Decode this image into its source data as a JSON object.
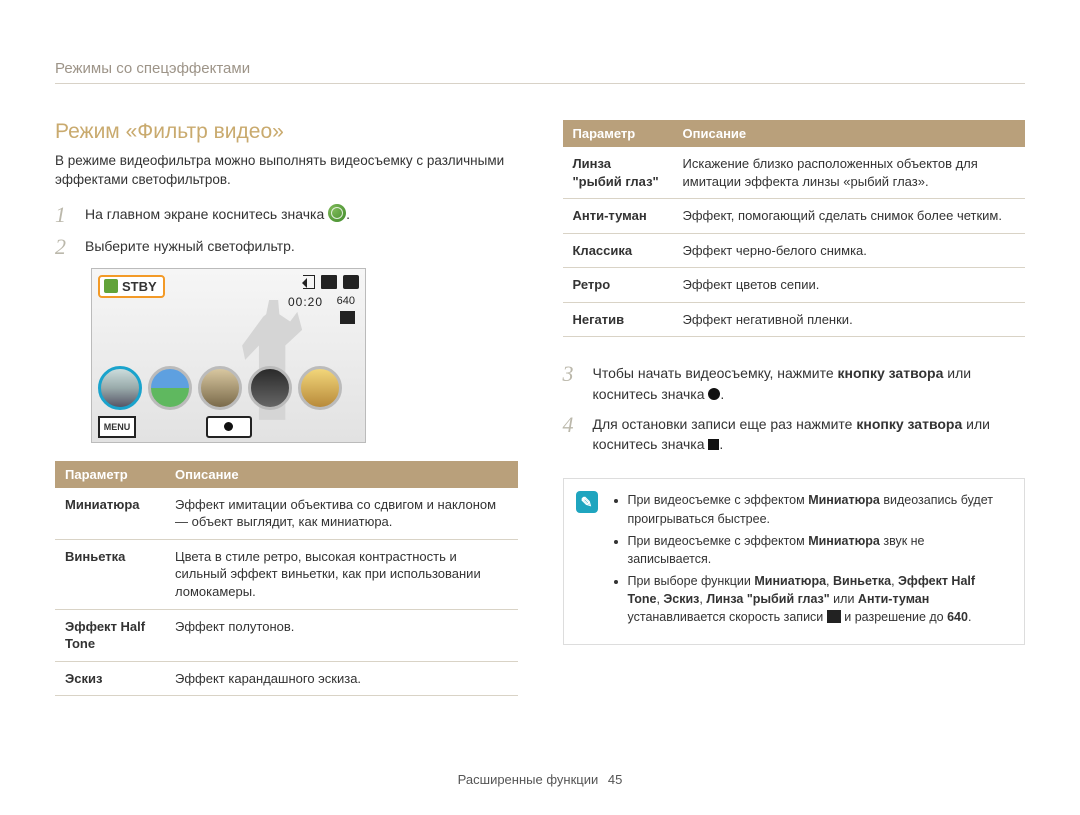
{
  "breadcrumb": "Режимы со спецэффектами",
  "title": "Режим «Фильтр видео»",
  "intro": "В режиме видеофильтра можно выполнять видеосъемку с различными эффектами светофильтров.",
  "steps": {
    "s1_pre": "На главном экране коснитесь значка ",
    "s1_post": ".",
    "s2": "Выберите нужный светофильтр.",
    "s3_pre": "Чтобы начать видеосъемку, нажмите ",
    "s3_bold": "кнопку затвора",
    "s3_mid": " или коснитесь значка ",
    "s3_post": ".",
    "s4_pre": "Для остановки записи еще раз нажмите ",
    "s4_bold": "кнопку затвора",
    "s4_mid": " или коснитесь значка ",
    "s4_post": "."
  },
  "screen": {
    "stby": "STBY",
    "time": "00:20",
    "res": "640",
    "menu": "MENU"
  },
  "table_headers": {
    "param": "Параметр",
    "desc": "Описание"
  },
  "table_left": [
    {
      "k": "Миниатюра",
      "v": "Эффект имитации объектива со сдвигом и наклоном — объект выглядит, как миниатюра."
    },
    {
      "k": "Виньетка",
      "v": "Цвета в стиле ретро, высокая контрастность и сильный эффект виньетки, как при использовании ломокамеры."
    },
    {
      "k": "Эффект Half Tone",
      "v": "Эффект полутонов."
    },
    {
      "k": "Эскиз",
      "v": "Эффект карандашного эскиза."
    }
  ],
  "table_right": [
    {
      "k": "Линза \"рыбий глаз\"",
      "v": "Искажение близко расположенных объектов для имитации эффекта линзы «рыбий глаз»."
    },
    {
      "k": "Анти-туман",
      "v": "Эффект, помогающий сделать снимок более четким."
    },
    {
      "k": "Классика",
      "v": "Эффект черно-белого снимка."
    },
    {
      "k": "Ретро",
      "v": "Эффект цветов сепии."
    },
    {
      "k": "Негатив",
      "v": "Эффект негативной пленки."
    }
  ],
  "note": {
    "l1_a": "При видеосъемке с эффектом ",
    "l1_b": "Миниатюра",
    "l1_c": " видеозапись будет проигрываться быстрее.",
    "l2_a": "При видеосъемке с эффектом ",
    "l2_b": "Миниатюра",
    "l2_c": " звук не записывается.",
    "l3_a": "При выборе функции ",
    "l3_m1": "Миниатюра",
    "l3_s1": ", ",
    "l3_m2": "Виньетка",
    "l3_s2": ", ",
    "l3_m3": "Эффект Half Tone",
    "l3_s3": ", ",
    "l3_m4": "Эскиз",
    "l3_s4": ", ",
    "l3_m5": "Линза \"рыбий глаз\"",
    "l3_s5": " или ",
    "l3_m6": "Анти-туман",
    "l3_b": " устанавливается скорость записи ",
    "l3_c": " и разрешение до ",
    "l3_res": "640",
    "l3_d": "."
  },
  "footer": {
    "section": "Расширенные функции",
    "page": "45"
  }
}
